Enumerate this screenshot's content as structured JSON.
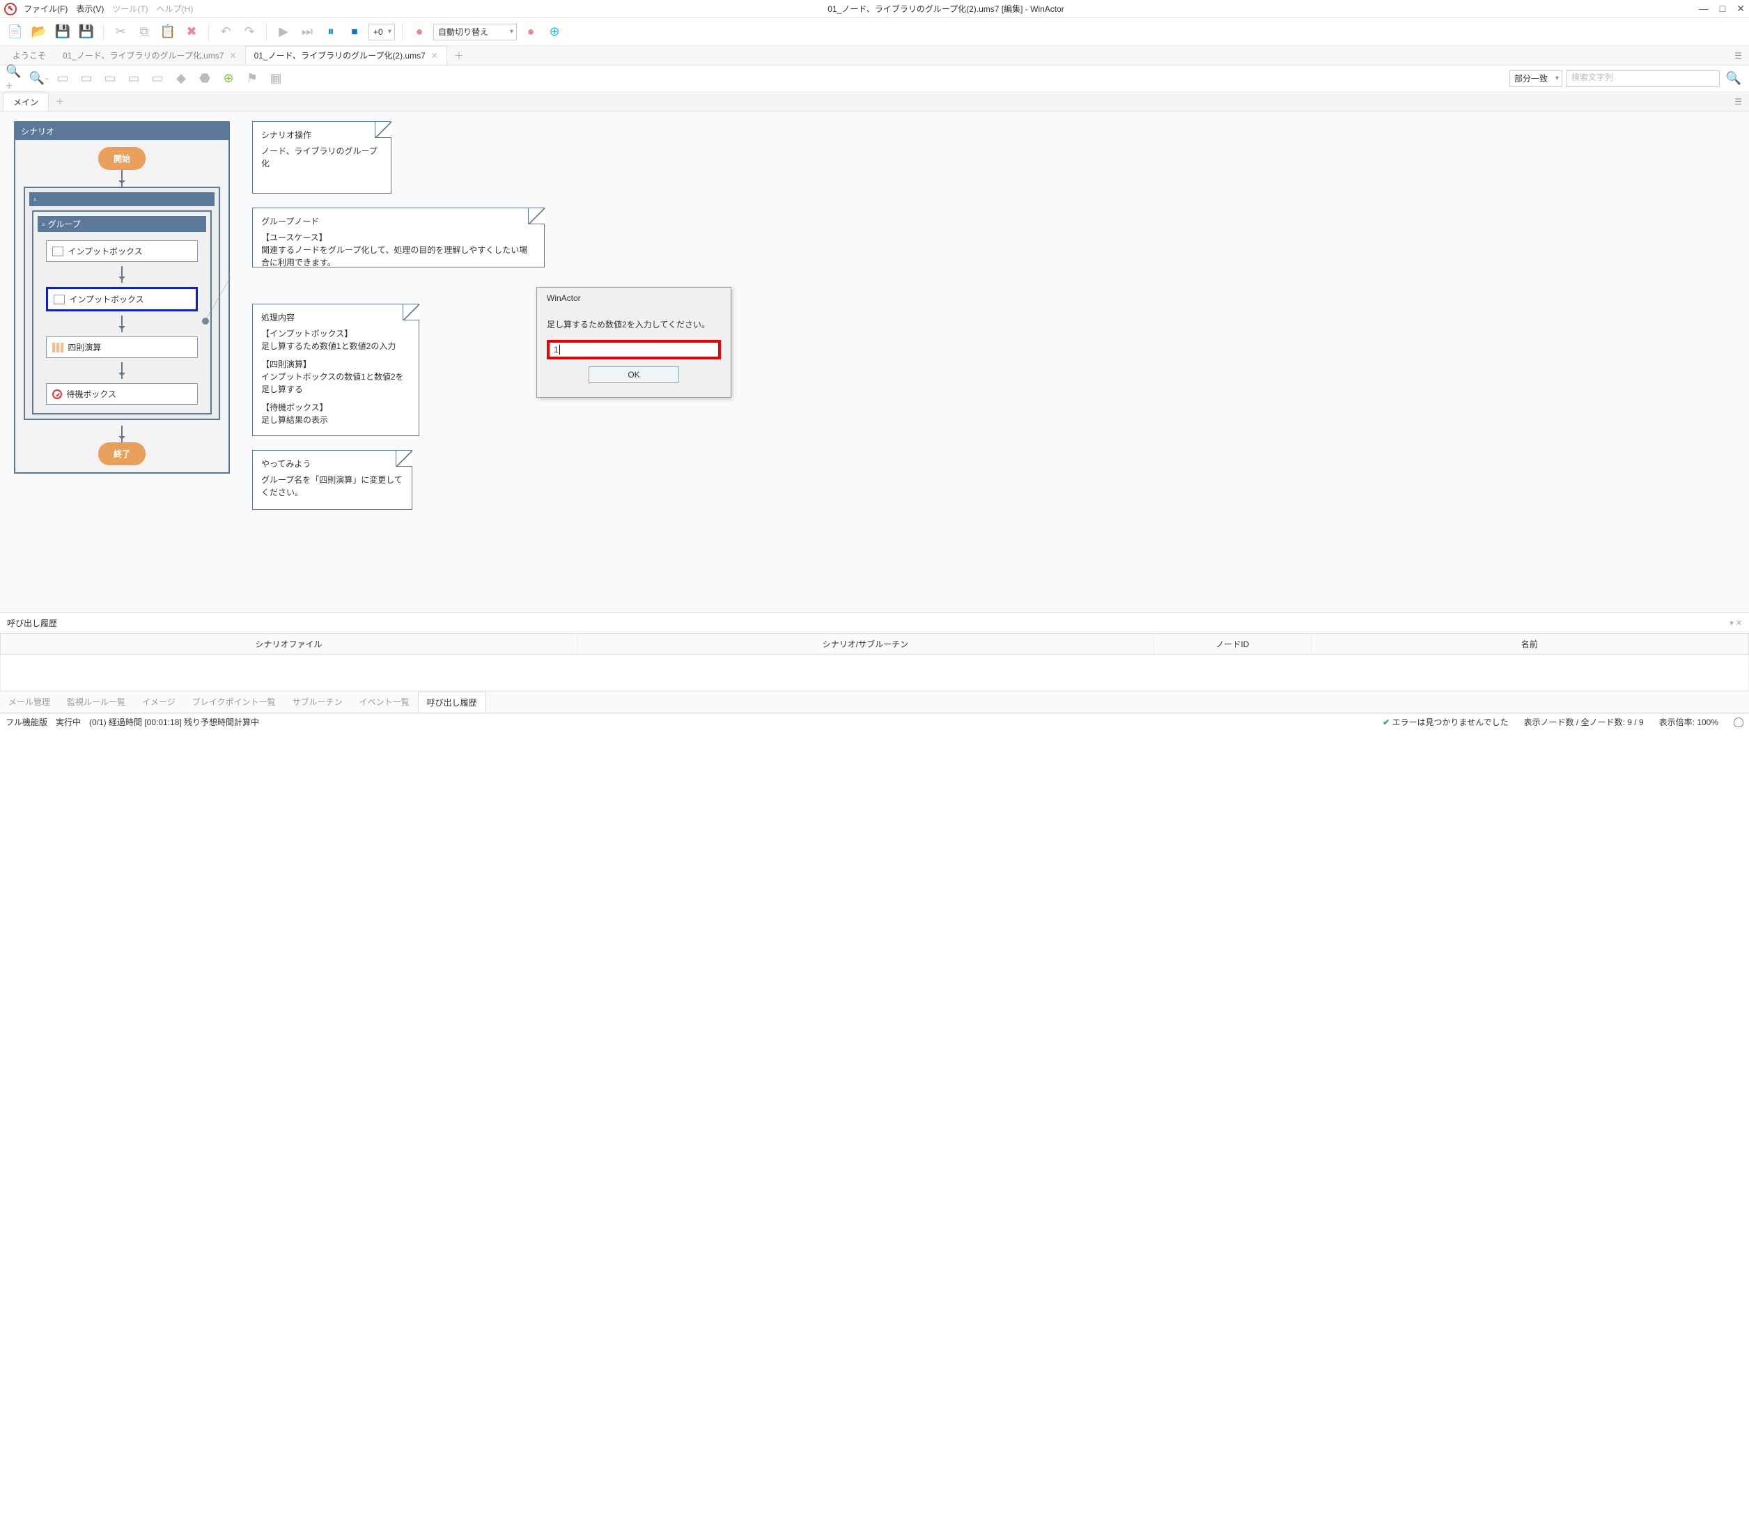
{
  "window": {
    "title": "01_ノード、ライブラリのグループ化(2).ums7 [編集] - WinActor"
  },
  "menu": {
    "file": "ファイル(F)",
    "view": "表示(V)",
    "tool": "ツール(T)",
    "help": "ヘルプ(H)"
  },
  "toolbar": {
    "speed_value": "+0",
    "mode_combo": "自動切り替え"
  },
  "docTabs": {
    "t0": "ようこそ",
    "t1": "01_ノード、ライブラリのグループ化.ums7",
    "t2": "01_ノード、ライブラリのグループ化(2).ums7"
  },
  "searchBar": {
    "match_mode": "部分一致",
    "placeholder": "検索文字列"
  },
  "innerTabs": {
    "main": "メイン"
  },
  "scenario": {
    "header": "シナリオ",
    "start": "開始",
    "group_label": "グループ",
    "n_input1": "インプットボックス",
    "n_input2": "インプットボックス",
    "n_calc": "四則演算",
    "n_wait": "待機ボックス",
    "end": "終了"
  },
  "notes": {
    "n1_title": "シナリオ操作",
    "n1_body": "ノード、ライブラリのグループ化",
    "n2_title": "グループノード",
    "n2_l1": "【ユースケース】",
    "n2_l2": "関連するノードをグループ化して、処理の目的を理解しやすくしたい場合に利用できます。",
    "n3_title": "処理内容",
    "n3_l1": "【インプットボックス】",
    "n3_l2": "足し算するため数値1と数値2の入力",
    "n3_l3": "【四則演算】",
    "n3_l4": "インプットボックスの数値1と数値2を足し算する",
    "n3_l5": "【待機ボックス】",
    "n3_l6": "足し算結果の表示",
    "n4_title": "やってみよう",
    "n4_body": "グループ名を「四則演算」に変更してください。"
  },
  "dialog": {
    "title": "WinActor",
    "message": "足し算するため数値2を入力してください。",
    "input_value": "1",
    "ok": "OK"
  },
  "callHistory": {
    "title": "呼び出し履歴",
    "col1": "シナリオファイル",
    "col2": "シナリオ/サブルーチン",
    "col3": "ノードID",
    "col4": "名前"
  },
  "bottomTabs": {
    "t1": "メール管理",
    "t2": "監視ルール一覧",
    "t3": "イメージ",
    "t4": "ブレイクポイント一覧",
    "t5": "サブルーチン",
    "t6": "イベント一覧",
    "t7": "呼び出し履歴"
  },
  "status": {
    "left": "フル機能版　実行中　(0/1) 経過時間 [00:01:18] 残り予想時間計算中",
    "err": "エラーは見つかりませんでした",
    "nodes": "表示ノード数 / 全ノード数: 9 / 9",
    "zoom": "表示倍率: 100%"
  }
}
